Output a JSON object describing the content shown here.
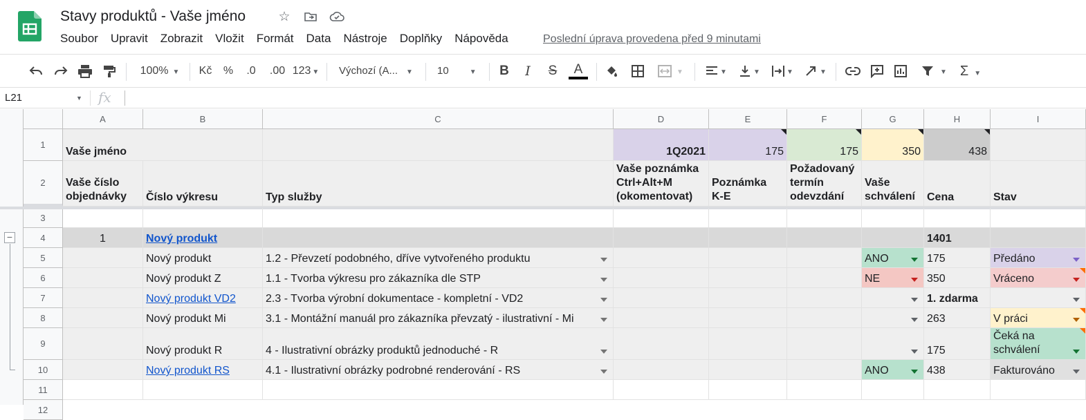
{
  "app": {
    "title": "Stavy produktů - Vaše jméno",
    "last_edit": "Poslední úprava provedena před 9 minutami",
    "menu": [
      "Soubor",
      "Upravit",
      "Zobrazit",
      "Vložit",
      "Formát",
      "Data",
      "Nástroje",
      "Doplňky",
      "Nápověda"
    ]
  },
  "toolbar": {
    "zoom": "100%",
    "currency": "Kč",
    "percent": "%",
    "dec_less": ".0",
    "dec_more": ".00",
    "more_formats": "123",
    "font": "Výchozí (A...",
    "font_size": "10"
  },
  "formula": {
    "cell_ref": "L21",
    "fx": "fx"
  },
  "columns": [
    "A",
    "B",
    "C",
    "D",
    "E",
    "F",
    "G",
    "H",
    "I"
  ],
  "rows_numbers": [
    "1",
    "2",
    "3",
    "4",
    "5",
    "6",
    "7",
    "8",
    "9",
    "10",
    "11",
    "12"
  ],
  "group_toggle": "−",
  "row1": {
    "a": "Vaše jméno",
    "d": "1Q2021",
    "e": "175",
    "f": "175",
    "g": "350",
    "h": "438"
  },
  "row2": {
    "a_line1": "Vaše číslo",
    "a_line2": "objednávky",
    "b": "Číslo výkresu",
    "c": "Typ služby",
    "d_line1": "Vaše poznámka",
    "d_line2": "Ctrl+Alt+M",
    "d_line3": "(okomentovat)",
    "e_line1": "Poznámka",
    "e_line2": "K-E",
    "f_line1": "Požadovaný",
    "f_line2": "termín",
    "f_line3": "odevzdání",
    "g_line1": "Vaše",
    "g_line2": "schválení",
    "h": "Cena",
    "i": "Stav"
  },
  "row4": {
    "a": "1",
    "b": "Nový produkt",
    "h": "1401"
  },
  "row5": {
    "b": "Nový produkt",
    "c": "1.2 - Převzetí podobného, dříve vytvořeného produktu",
    "g": "ANO",
    "h": "175",
    "i": "Předáno"
  },
  "row6": {
    "b": "Nový produkt Z",
    "c": "1.1 - Tvorba výkresu pro zákazníka dle STP",
    "g": "NE",
    "h": "350",
    "i": "Vráceno"
  },
  "row7": {
    "b": "Nový produkt VD2",
    "c": "2.3 - Tvorba výrobní dokumentace - kompletní - VD2",
    "g": "",
    "h": "1. zdarma",
    "i": ""
  },
  "row8": {
    "b": "Nový produkt Mi",
    "c": "3.1 - Montážní manuál pro zákazníka převzatý - ilustrativní - Mi",
    "g": "",
    "h": "263",
    "i": "V práci"
  },
  "row9": {
    "b": "Nový produkt R",
    "c": "4 - Ilustrativní obrázky produktů jednoduché - R",
    "g": "",
    "h": "175",
    "i_line1": "Čeká na",
    "i_line2": "schválení"
  },
  "row10": {
    "b": "Nový produkt RS",
    "c": "4.1 - Ilustrativní obrázky podrobné renderování - RS",
    "g": "ANO",
    "h": "438",
    "i": "Fakturováno"
  },
  "colors": {
    "purple": "#d9d2e9",
    "green": "#d9ead3",
    "yellow": "#fff2cc",
    "gray": "#cccccc",
    "row_gray": "#efefef",
    "ano": "#b7e1cd",
    "ne": "#f4c7c3",
    "status_purple": "#d9d2e9",
    "status_red": "#f4cccc",
    "status_yellow": "#fff2cc",
    "status_green": "#b7e1cd",
    "status_gray": "#e0e0e0",
    "sheets_green": "#0f9d58",
    "link": "#1155cc"
  }
}
